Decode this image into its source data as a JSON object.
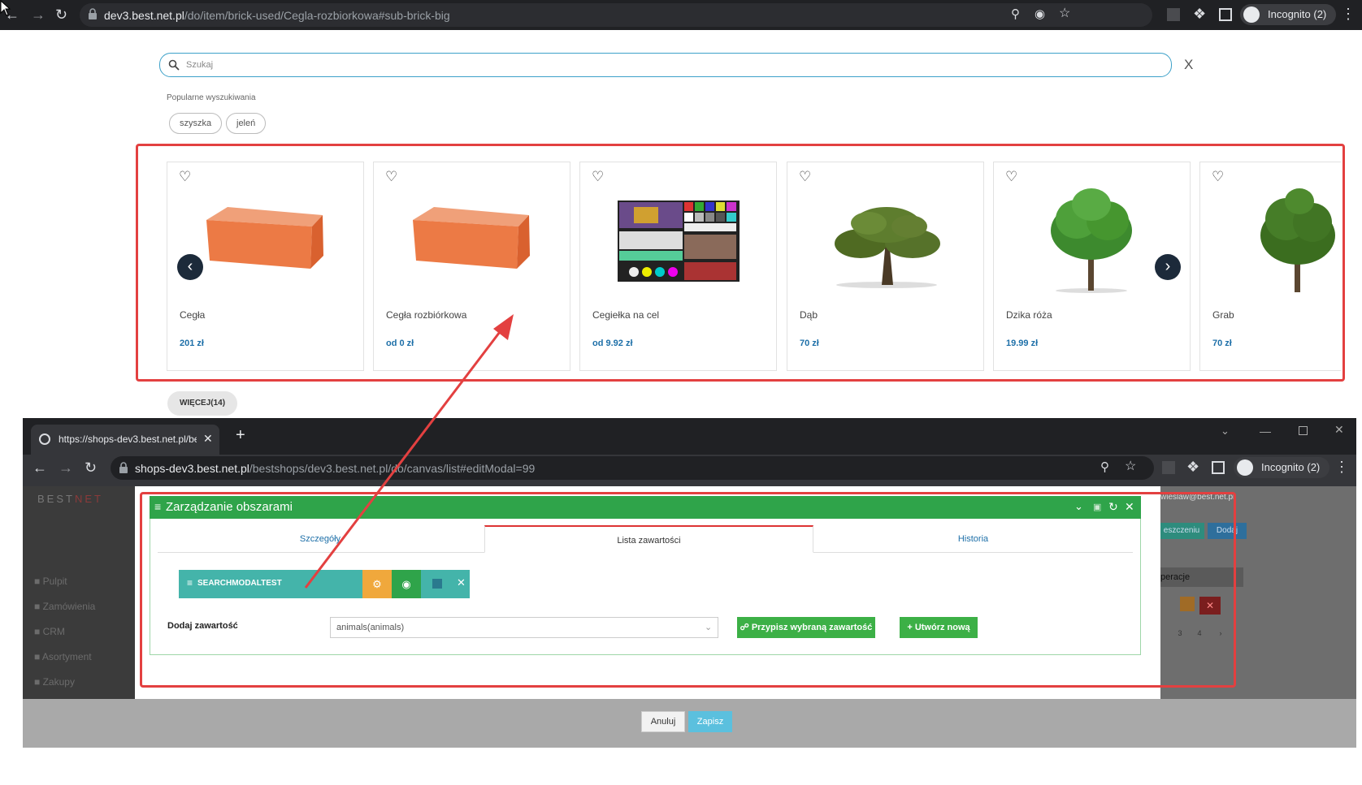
{
  "top_browser": {
    "url_host": "dev3.best.net.pl",
    "url_path": "/do/item/brick-used/Cegla-rozbiorkowa#sub-brick-big",
    "incognito": "Incognito (2)"
  },
  "search": {
    "placeholder": "Szukaj",
    "close": "X",
    "popular_label": "Popularne wyszukiwania",
    "chips": [
      "szyszka",
      "jeleń"
    ]
  },
  "products": [
    {
      "name": "Cegła",
      "price": "201 zł",
      "image": "brick"
    },
    {
      "name": "Cegła rozbiórkowa",
      "price": "od 0 zł",
      "image": "brick"
    },
    {
      "name": "Cegiełka na cel",
      "price": "od 9.92 zł",
      "image": "test-chart"
    },
    {
      "name": "Dąb",
      "price": "70 zł",
      "image": "oak"
    },
    {
      "name": "Dzika róża",
      "price": "19.99 zł",
      "image": "tree"
    },
    {
      "name": "Grab",
      "price": "70 zł",
      "image": "tree"
    }
  ],
  "more_button": "WIĘCEJ(14)",
  "second_window": {
    "tab_title": "https://shops-dev3.best.net.pl/be",
    "url_host": "shops-dev3.best.net.pl",
    "url_path": "/bestshops/dev3.best.net.pl/do/canvas/list#editModal=99",
    "incognito": "Incognito (2)",
    "logo_a": "BEST",
    "logo_b": "NET",
    "user_email": "wieslaw@best.net.pl",
    "sidebar": [
      "Pulpit",
      "Zamówienia",
      "CRM",
      "Asortyment",
      "Zakupy"
    ],
    "bg_buttons": [
      "eszczeniu",
      "Dodaj"
    ],
    "bg_label": "peracje",
    "bg_pages": [
      "3",
      "4",
      "›"
    ]
  },
  "modal": {
    "title": "Zarządzanie obszarami",
    "tabs": [
      "Szczegóły",
      "Lista zawartości",
      "Historia"
    ],
    "active_tab": 1,
    "item_label": "SEARCHMODALTEST",
    "add_label": "Dodaj zawartość",
    "select_value": "animals(animals)",
    "assign_button": "Przypisz wybraną zawartość",
    "create_button": "Utwórz nową",
    "cancel": "Anuluj",
    "save": "Zapisz"
  },
  "colors": {
    "accent_red": "#e34040",
    "green": "#2fa44a",
    "teal": "#44b4aa",
    "orange": "#f0a83c",
    "price_blue": "#1d6fa8"
  }
}
